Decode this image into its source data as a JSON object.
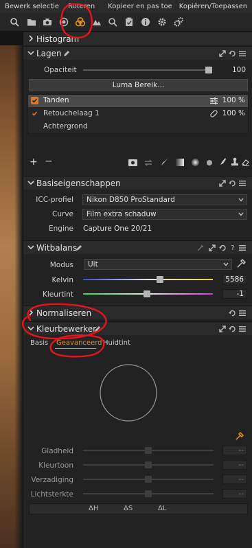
{
  "menubar": {
    "items": [
      "Bewerk selectie",
      "Roteren",
      "Kopieer en pas toe",
      "Kopiëren/Toepassen"
    ]
  },
  "tool_tabs": [
    "library-icon",
    "capture-icon",
    "lens-icon",
    "color-icon",
    "exposure-icon",
    "details-icon",
    "adjustments-icon",
    "metadata-icon",
    "output-icon",
    "batch-icon"
  ],
  "panels": {
    "histogram": {
      "title": "Histogram"
    },
    "lagen": {
      "title": "Lagen",
      "opacity_label": "Opaciteit",
      "opacity_value": "100",
      "opacity_fraction": 1.0,
      "luma_button": "Luma Bereik...",
      "layers": [
        {
          "name": "Tanden",
          "value": "100 %",
          "selected": true,
          "checked": true
        },
        {
          "name": "Retouchelaag 1",
          "value": "100 %",
          "selected": false,
          "checked": true
        },
        {
          "name": "Achtergrond",
          "value": "",
          "selected": false,
          "checked": false
        }
      ]
    },
    "basis": {
      "title": "Basiseigenschappen",
      "icc_label": "ICC-profiel",
      "icc_value": "Nikon D850 ProStandard",
      "curve_label": "Curve",
      "curve_value": "Film extra schaduw",
      "engine_label": "Engine",
      "engine_value": "Capture One 20/21"
    },
    "witbalans": {
      "title": "Witbalans",
      "mode_label": "Modus",
      "mode_value": "Uit",
      "kelvin_label": "Kelvin",
      "kelvin_value": "5586",
      "kelvin_fraction": 0.6,
      "tint_label": "Kleurtint",
      "tint_value": "-1",
      "tint_fraction": 0.49
    },
    "normaliseren": {
      "title": "Normaliseren"
    },
    "kleurbewerker": {
      "title": "Kleurbewerker",
      "tabs": [
        "Basis",
        "Geavanceerd",
        "Huidtint"
      ],
      "active_tab": "Geavanceerd",
      "sliders": [
        {
          "label": "Gladheid",
          "value": "--"
        },
        {
          "label": "Kleurtoon",
          "value": "--"
        },
        {
          "label": "Verzadiging",
          "value": "--"
        },
        {
          "label": "Lichtsterkte",
          "value": "--"
        }
      ],
      "delta_labels": [
        "ΔH",
        "ΔS",
        "ΔL"
      ]
    }
  },
  "colors": {
    "accent_orange": "#e07a1a",
    "annotation_red": "#e8141c"
  }
}
